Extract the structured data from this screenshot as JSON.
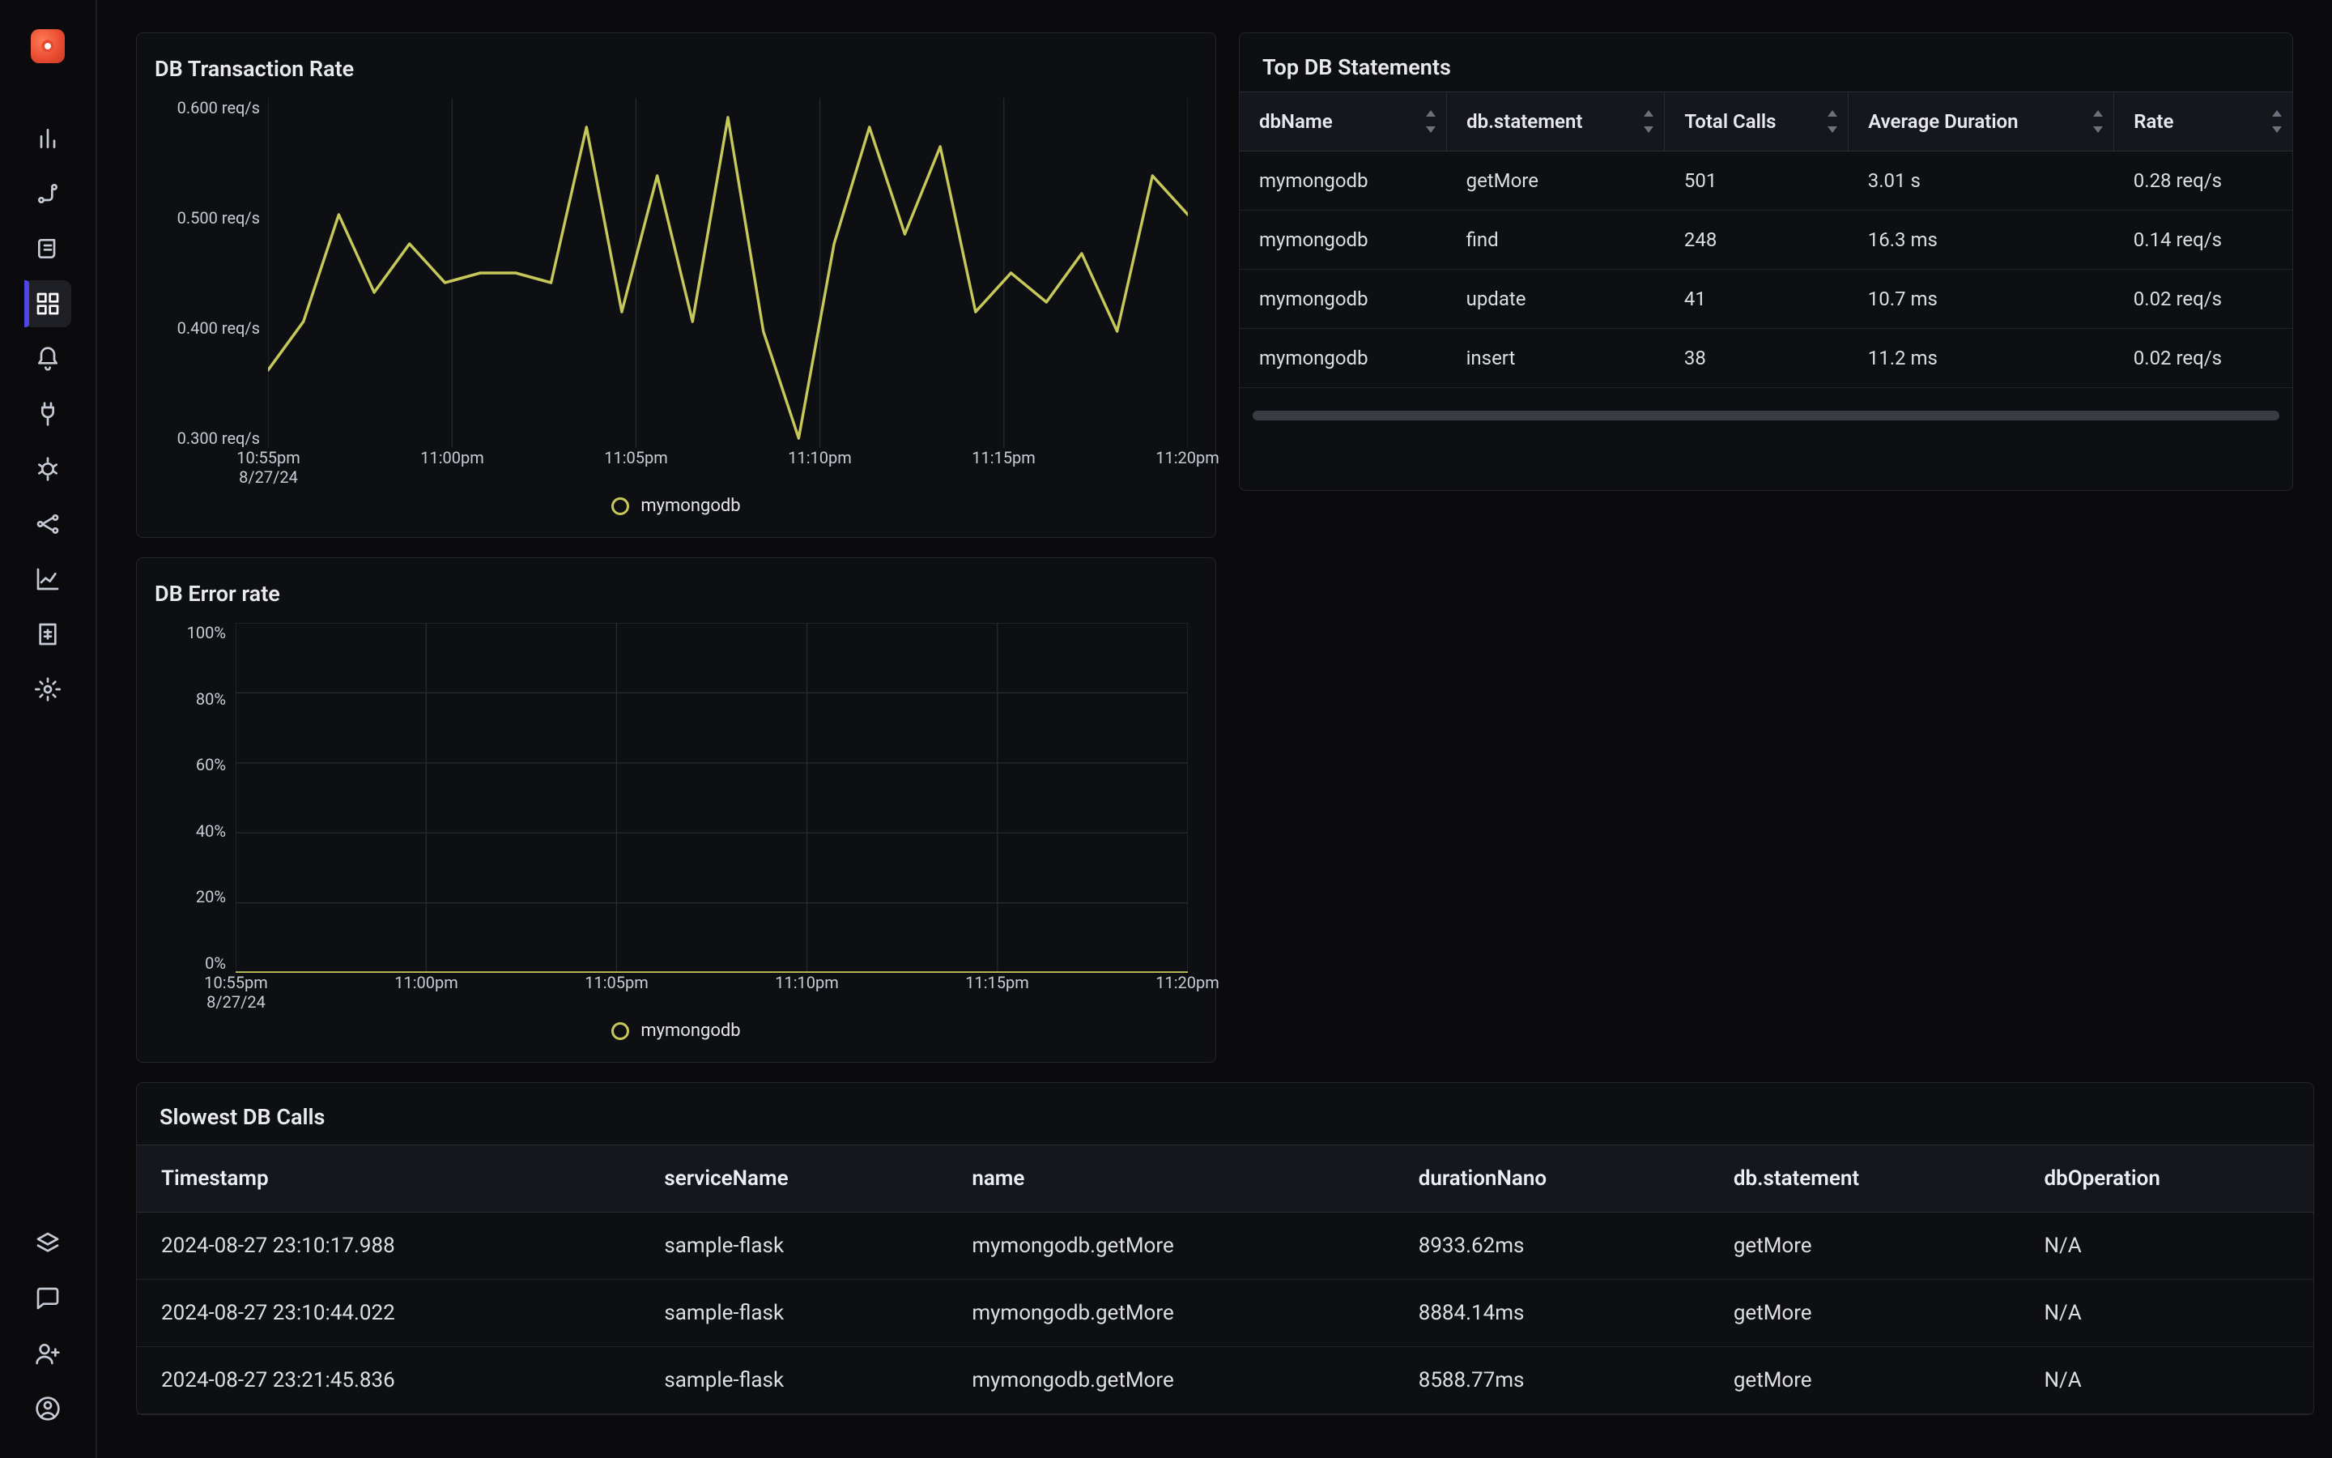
{
  "sidebar": {
    "items": [
      {
        "name": "metrics"
      },
      {
        "name": "traces"
      },
      {
        "name": "logs"
      },
      {
        "name": "dashboards"
      },
      {
        "name": "alerts"
      },
      {
        "name": "integrations"
      },
      {
        "name": "debug"
      },
      {
        "name": "service-map"
      },
      {
        "name": "usage"
      },
      {
        "name": "billing"
      },
      {
        "name": "settings"
      }
    ],
    "bottom": [
      {
        "name": "layers"
      },
      {
        "name": "support"
      },
      {
        "name": "invite"
      },
      {
        "name": "account"
      }
    ]
  },
  "charts": {
    "transaction": {
      "title": "DB Transaction Rate",
      "legend": "mymongodb",
      "y_ticks": [
        "0.600 req/s",
        "0.500 req/s",
        "0.400 req/s",
        "0.300 req/s"
      ],
      "x_ticks": [
        {
          "t": "10:55pm",
          "d": "8/27/24"
        },
        {
          "t": "11:00pm",
          "d": ""
        },
        {
          "t": "11:05pm",
          "d": ""
        },
        {
          "t": "11:10pm",
          "d": ""
        },
        {
          "t": "11:15pm",
          "d": ""
        },
        {
          "t": "11:20pm",
          "d": ""
        }
      ]
    },
    "error": {
      "title": "DB Error rate",
      "legend": "mymongodb",
      "y_ticks": [
        "100%",
        "80%",
        "60%",
        "40%",
        "20%",
        "0%"
      ],
      "x_ticks": [
        {
          "t": "10:55pm",
          "d": "8/27/24"
        },
        {
          "t": "11:00pm",
          "d": ""
        },
        {
          "t": "11:05pm",
          "d": ""
        },
        {
          "t": "11:10pm",
          "d": ""
        },
        {
          "t": "11:15pm",
          "d": ""
        },
        {
          "t": "11:20pm",
          "d": ""
        }
      ]
    }
  },
  "top_statements": {
    "title": "Top DB Statements",
    "columns": [
      "dbName",
      "db.statement",
      "Total Calls",
      "Average Duration",
      "Rate"
    ],
    "rows": [
      {
        "dbName": "mymongodb",
        "statement": "getMore",
        "calls": "501",
        "avg": "3.01 s",
        "rate": "0.28 req/s"
      },
      {
        "dbName": "mymongodb",
        "statement": "find",
        "calls": "248",
        "avg": "16.3 ms",
        "rate": "0.14 req/s"
      },
      {
        "dbName": "mymongodb",
        "statement": "update",
        "calls": "41",
        "avg": "10.7 ms",
        "rate": "0.02 req/s"
      },
      {
        "dbName": "mymongodb",
        "statement": "insert",
        "calls": "38",
        "avg": "11.2 ms",
        "rate": "0.02 req/s"
      }
    ]
  },
  "slowest": {
    "title": "Slowest DB Calls",
    "columns": [
      "Timestamp",
      "serviceName",
      "name",
      "durationNano",
      "db.statement",
      "dbOperation"
    ],
    "rows": [
      {
        "ts": "2024-08-27 23:10:17.988",
        "svc": "sample-flask",
        "name": "mymongodb.getMore",
        "dur": "8933.62ms",
        "stmt": "getMore",
        "op": "N/A"
      },
      {
        "ts": "2024-08-27 23:10:44.022",
        "svc": "sample-flask",
        "name": "mymongodb.getMore",
        "dur": "8884.14ms",
        "stmt": "getMore",
        "op": "N/A"
      },
      {
        "ts": "2024-08-27 23:21:45.836",
        "svc": "sample-flask",
        "name": "mymongodb.getMore",
        "dur": "8588.77ms",
        "stmt": "getMore",
        "op": "N/A"
      }
    ]
  },
  "chart_data": [
    {
      "type": "line",
      "title": "DB Transaction Rate",
      "ylabel": "req/s",
      "ylim": [
        0.27,
        0.63
      ],
      "x": [
        "10:53",
        "10:55",
        "10:57",
        "10:59",
        "11:00",
        "11:01",
        "11:02",
        "11:03",
        "11:04",
        "11:05",
        "11:06",
        "11:07",
        "11:08",
        "11:09",
        "11:10",
        "11:11",
        "11:12",
        "11:13",
        "11:14",
        "11:15",
        "11:16",
        "11:17",
        "11:18",
        "11:19",
        "11:20",
        "11:21",
        "11:22"
      ],
      "series": [
        {
          "name": "mymongodb",
          "values": [
            0.35,
            0.4,
            0.51,
            0.43,
            0.48,
            0.44,
            0.45,
            0.45,
            0.44,
            0.6,
            0.41,
            0.55,
            0.4,
            0.61,
            0.39,
            0.28,
            0.48,
            0.6,
            0.49,
            0.58,
            0.41,
            0.45,
            0.42,
            0.47,
            0.39,
            0.55,
            0.51
          ]
        }
      ]
    },
    {
      "type": "line",
      "title": "DB Error rate",
      "ylabel": "%",
      "ylim": [
        0,
        100
      ],
      "x": [
        "10:55",
        "11:00",
        "11:05",
        "11:10",
        "11:15",
        "11:20"
      ],
      "series": [
        {
          "name": "mymongodb",
          "values": [
            0,
            0,
            0,
            0,
            0,
            0
          ]
        }
      ]
    }
  ]
}
